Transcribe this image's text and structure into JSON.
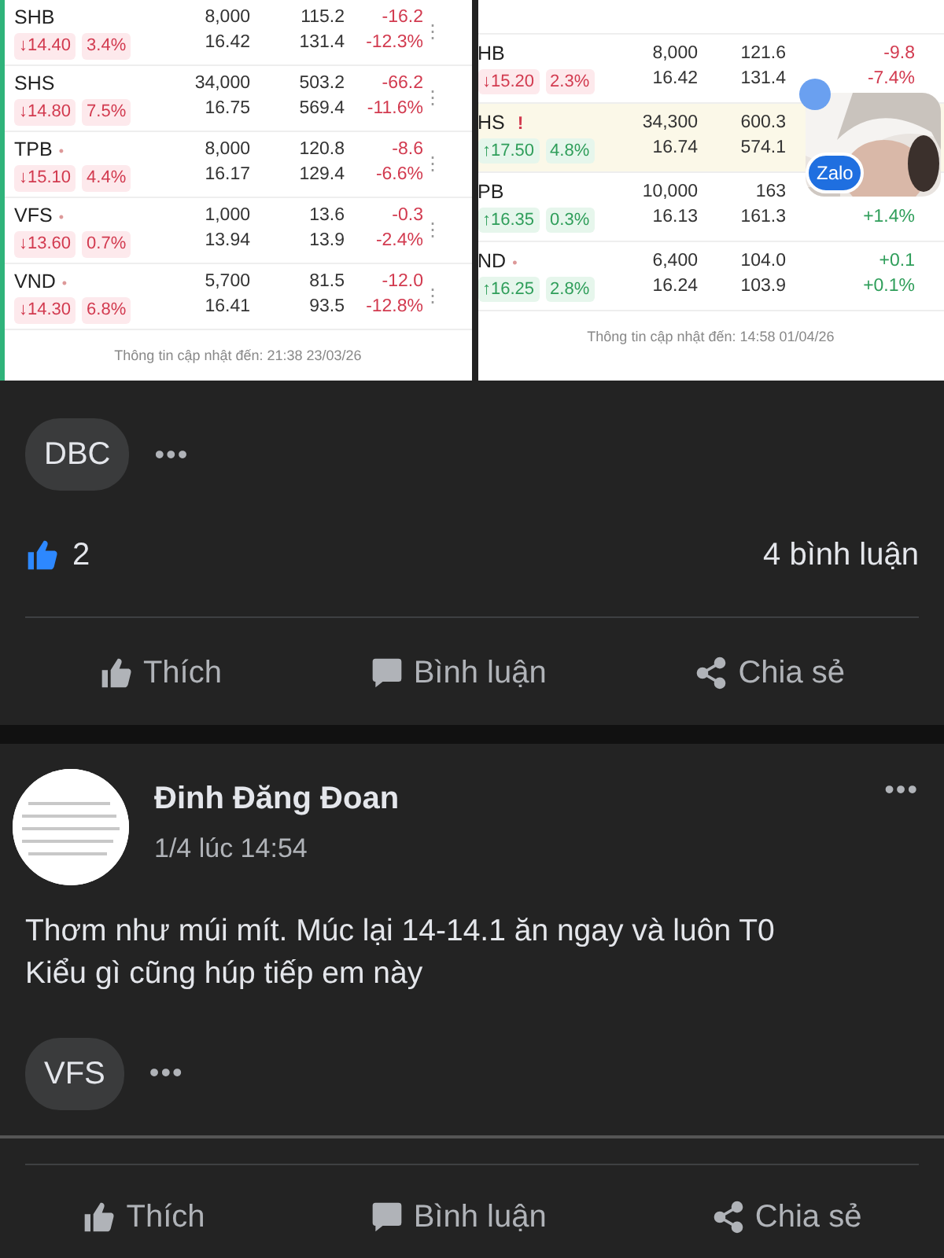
{
  "shared_images": [
    {
      "rows": [
        {
          "ticker": "SHB",
          "falling": true,
          "highlighted": false,
          "arrow": "↓",
          "price": "14.40",
          "pct": "3.4%",
          "volume": "8,000",
          "avg": "16.42",
          "value": "115.2",
          "value_prev": "131.4",
          "change": "-16.2",
          "change_pct": "-12.3%",
          "menu": "⋮"
        },
        {
          "ticker": "SHS",
          "falling": true,
          "highlighted": false,
          "arrow": "↓",
          "price": "14.80",
          "pct": "7.5%",
          "volume": "34,000",
          "avg": "16.75",
          "value": "503.2",
          "value_prev": "569.4",
          "change": "-66.2",
          "change_pct": "-11.6%",
          "menu": "⋮"
        },
        {
          "ticker": "TPB",
          "mark": "•",
          "falling": true,
          "highlighted": false,
          "arrow": "↓",
          "price": "15.10",
          "pct": "4.4%",
          "volume": "8,000",
          "avg": "16.17",
          "value": "120.8",
          "value_prev": "129.4",
          "change": "-8.6",
          "change_pct": "-6.6%",
          "menu": "⋮"
        },
        {
          "ticker": "VFS",
          "mark": "•",
          "falling": true,
          "highlighted": false,
          "arrow": "↓",
          "price": "13.60",
          "pct": "0.7%",
          "volume": "1,000",
          "avg": "13.94",
          "value": "13.6",
          "value_prev": "13.9",
          "change": "-0.3",
          "change_pct": "-2.4%",
          "menu": "⋮"
        },
        {
          "ticker": "VND",
          "mark": "•",
          "falling": true,
          "highlighted": false,
          "arrow": "↓",
          "price": "14.30",
          "pct": "6.8%",
          "volume": "5,700",
          "avg": "16.41",
          "value": "81.5",
          "value_prev": "93.5",
          "change": "-12.0",
          "change_pct": "-12.8%",
          "menu": "⋮"
        }
      ],
      "footer": "Thông tin cập nhật đến: 21:38 23/03/26"
    },
    {
      "rows": [
        {
          "ticker": "HB",
          "falling": true,
          "highlighted": false,
          "arrow": "↓",
          "price": "15.20",
          "pct": "2.3%",
          "volume": "8,000",
          "avg": "16.42",
          "value": "121.6",
          "value_prev": "131.4",
          "change": "-9.8",
          "change_pct": "-7.4%"
        },
        {
          "ticker": "HS",
          "mark": "!",
          "falling": false,
          "highlighted": true,
          "arrow": "↑",
          "price": "17.50",
          "pct": "4.8%",
          "volume": "34,300",
          "avg": "16.74",
          "value": "600.3",
          "value_prev": "574.1"
        },
        {
          "ticker": "PB",
          "falling": false,
          "highlighted": false,
          "arrow": "↑",
          "price": "16.35",
          "pct": "0.3%",
          "volume": "10,000",
          "avg": "16.13",
          "value": "163",
          "value_prev": "161.3",
          "change_pct": "+1.4%"
        },
        {
          "ticker": "ND",
          "mark": "•",
          "falling": false,
          "highlighted": false,
          "arrow": "↑",
          "price": "16.25",
          "pct": "2.8%",
          "volume": "6,400",
          "avg": "16.24",
          "value": "104.0",
          "value_prev": "103.9",
          "change": "+0.1",
          "change_pct": "+0.1%"
        }
      ],
      "footer": "Thông tin cập nhật đến: 14:58 01/04/26"
    }
  ],
  "chat_bubble": {
    "badge": "Zalo"
  },
  "post_1": {
    "tags": [
      "DBC"
    ],
    "more": "•••",
    "likes": "2",
    "comments": "4 bình luận",
    "actions": [
      {
        "kind": "like",
        "label": "Thích"
      },
      {
        "kind": "comment",
        "label": "Bình luận"
      },
      {
        "kind": "share",
        "label": "Chia sẻ"
      }
    ]
  },
  "post_2": {
    "author": "Đinh Đăng Đoan",
    "time": "1/4 lúc 14:54",
    "menu": "•••",
    "text": [
      "Thơm như múi mít. Múc lại 14-14.1 ăn ngay và luôn T0",
      "Kiểu gì cũng húp tiếp em này"
    ],
    "tags": [
      "VFS"
    ],
    "more": "•••",
    "actions": [
      {
        "kind": "like",
        "label": "Thích"
      },
      {
        "kind": "comment",
        "label": "Bình luận"
      },
      {
        "kind": "share",
        "label": "Chia sẻ"
      }
    ]
  }
}
